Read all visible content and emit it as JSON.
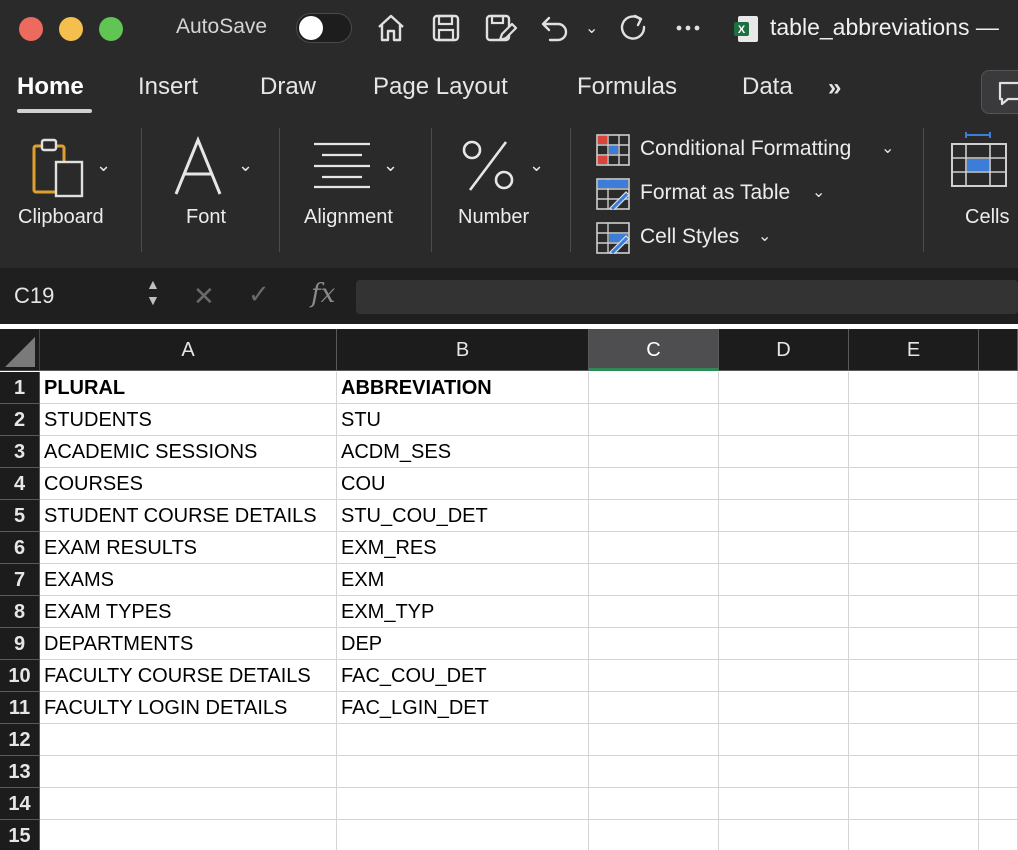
{
  "titlebar": {
    "autosave_label": "AutoSave",
    "document_title": "table_abbreviations —",
    "icons": [
      "home-icon",
      "save-icon",
      "save-as-icon",
      "undo-icon",
      "redo-icon",
      "more-icon"
    ]
  },
  "tabs": [
    {
      "label": "Home",
      "active": true
    },
    {
      "label": "Insert"
    },
    {
      "label": "Draw"
    },
    {
      "label": "Page Layout"
    },
    {
      "label": "Formulas"
    },
    {
      "label": "Data"
    }
  ],
  "ribbon": {
    "clipboard": "Clipboard",
    "font": "Font",
    "alignment": "Alignment",
    "number": "Number",
    "conditional_formatting": "Conditional Formatting",
    "format_as_table": "Format as Table",
    "cell_styles": "Cell Styles",
    "cells": "Cells"
  },
  "formula_bar": {
    "name_box": "C19",
    "fx": "fx",
    "value": ""
  },
  "grid": {
    "columns": [
      "A",
      "B",
      "C",
      "D",
      "E"
    ],
    "selected_column": "C",
    "rows": [
      {
        "num": "1",
        "a": "PLURAL",
        "b": "ABBREVIATION"
      },
      {
        "num": "2",
        "a": "STUDENTS",
        "b": "STU"
      },
      {
        "num": "3",
        "a": "ACADEMIC SESSIONS",
        "b": "ACDM_SES"
      },
      {
        "num": "4",
        "a": "COURSES",
        "b": "COU"
      },
      {
        "num": "5",
        "a": "STUDENT COURSE DETAILS",
        "b": "STU_COU_DET"
      },
      {
        "num": "6",
        "a": "EXAM RESULTS",
        "b": "EXM_RES"
      },
      {
        "num": "7",
        "a": "EXAMS",
        "b": "EXM"
      },
      {
        "num": "8",
        "a": "EXAM TYPES",
        "b": "EXM_TYP"
      },
      {
        "num": "9",
        "a": "DEPARTMENTS",
        "b": "DEP"
      },
      {
        "num": "10",
        "a": "FACULTY COURSE DETAILS",
        "b": "FAC_COU_DET"
      },
      {
        "num": "11",
        "a": "FACULTY LOGIN DETAILS",
        "b": "FAC_LGIN_DET"
      },
      {
        "num": "12",
        "a": "",
        "b": ""
      },
      {
        "num": "13",
        "a": "",
        "b": ""
      },
      {
        "num": "14",
        "a": "",
        "b": ""
      },
      {
        "num": "15",
        "a": "",
        "b": ""
      }
    ]
  }
}
